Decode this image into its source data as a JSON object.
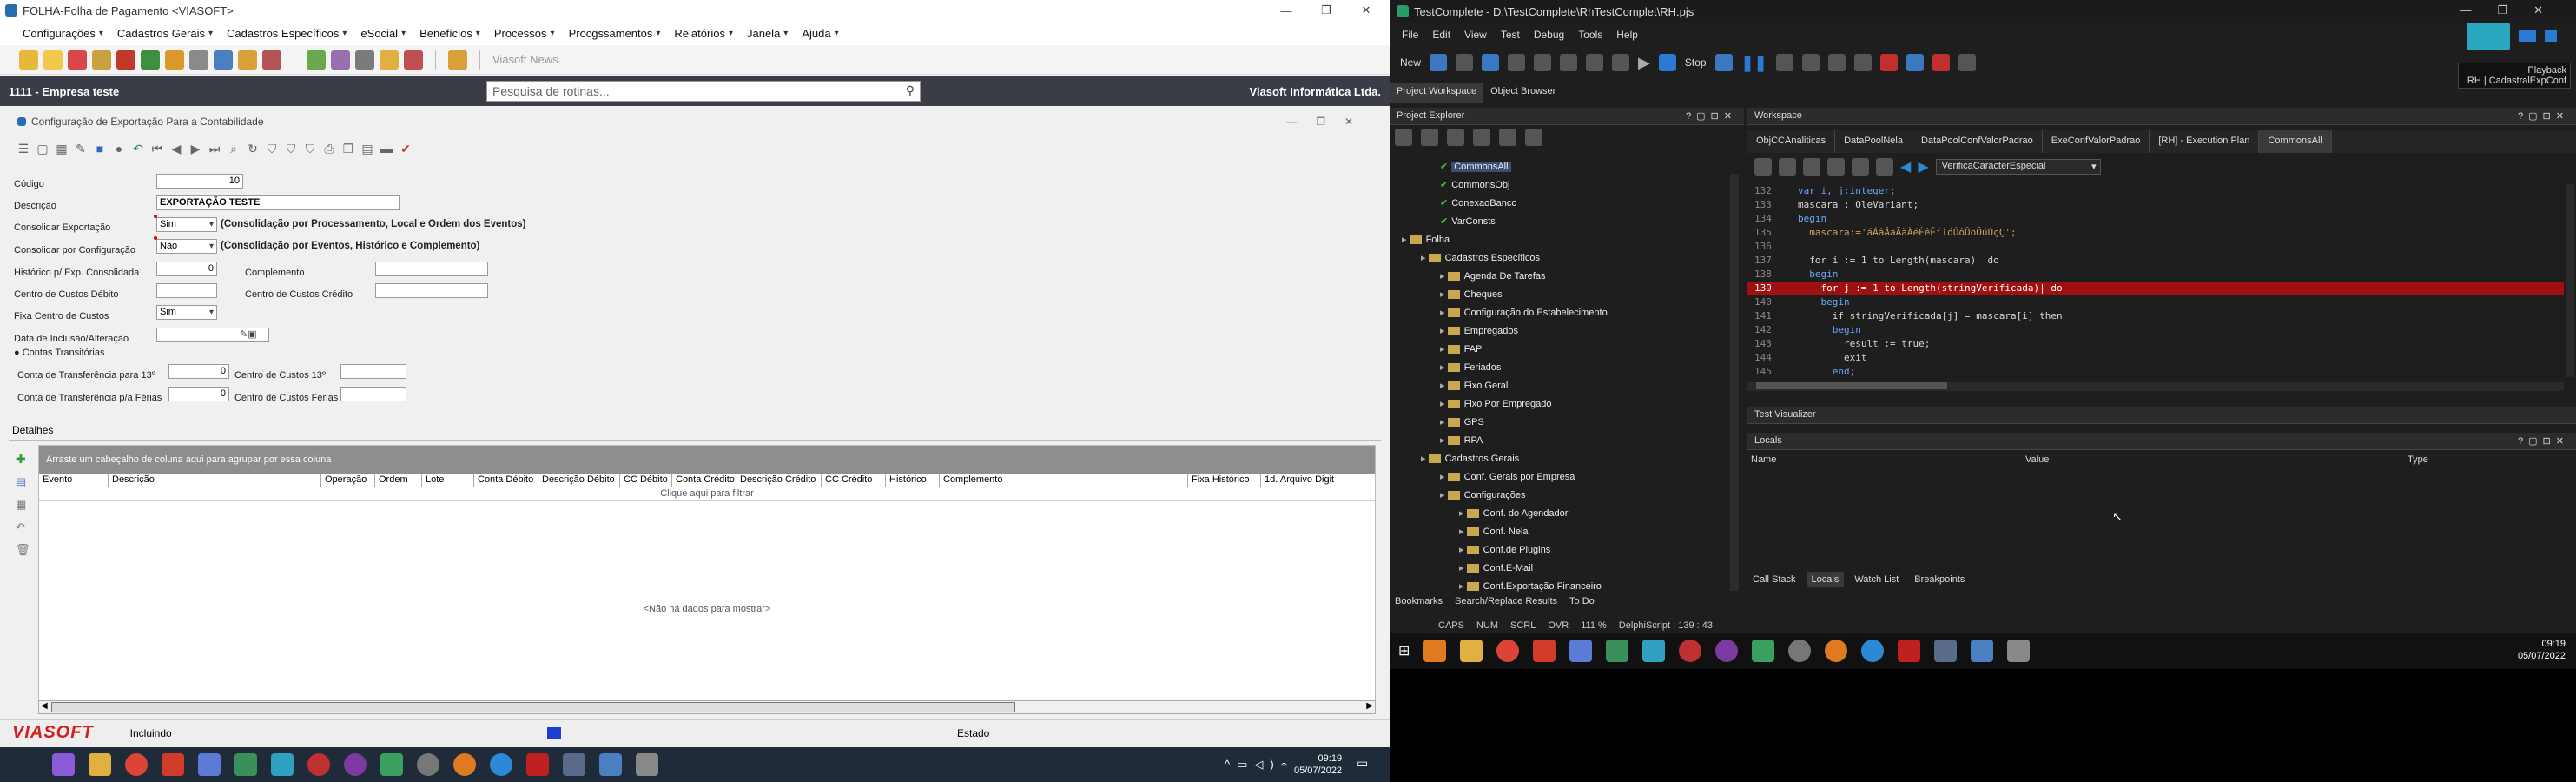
{
  "left_app": {
    "title": "FOLHA-Folha de Pagamento <VIASOFT>",
    "menus": [
      "Configurações",
      "Cadastros Gerais",
      "Cadastros Específicos",
      "eSocial",
      "Benefícios",
      "Processos",
      "Procgssamentos",
      "Relatórios",
      "Janela",
      "Ajuda"
    ],
    "news_label": "Viasoft News",
    "company": "1111 - Empresa teste",
    "search_placeholder": "Pesquisa de rotinas...",
    "brand": "Viasoft Informática Ltda.",
    "form_title": "Configuração de Exportação Para a Contabilidade",
    "fields": {
      "codigo_label": "Código",
      "codigo_value": "10",
      "descricao_label": "Descrição",
      "descricao_value": "EXPORTAÇÃO TESTE",
      "consolidar_exp_label": "Consolidar Exportação",
      "consolidar_exp_value": "Sim",
      "consolidar_exp_hint": "(Consolidação por Processamento, Local e Ordem dos Eventos)",
      "consolidar_cfg_label": "Consolidar por Configuração",
      "consolidar_cfg_value": "Não",
      "consolidar_cfg_hint": "(Consolidação por Eventos, Histórico e Complemento)",
      "historico_label": "Histórico p/ Exp. Consolidada",
      "historico_value": "0",
      "complemento_label": "Complemento",
      "cc_debito_label": "Centro de Custos Débito",
      "cc_credito_label": "Centro de Custos Crédito",
      "fixa_cc_label": "Fixa Centro de Custos",
      "fixa_cc_value": "Sim",
      "data_label": "Data de Inclusão/Alteração",
      "contas_label": "Contas Transitórias",
      "ct13_label": "Conta de Transferência para 13º",
      "ct13_value": "0",
      "cc13_label": "Centro de Custos 13º",
      "ctferias_label": "Conta de Transferência p/a Férias",
      "ctferias_value": "0",
      "ccferias_label": "Centro de Custos Férias"
    },
    "tab_label": "Detalhes",
    "group_hint": "Arraste um cabeçalho de coluna aqui para agrupar por essa coluna",
    "columns": [
      "Evento",
      "Descrição",
      "Operação",
      "Ordem",
      "Lote",
      "Conta Débito",
      "Descrição Débito",
      "CC Débito",
      "Conta Crédito",
      "Descrição Crédito",
      "CC Crédito",
      "Histórico",
      "Complemento",
      "Fixa Histórico",
      "1d. Arquivo Digita"
    ],
    "filter_hint": "Clique aqui para filtrar",
    "empty_text": "<Não há dados para mostrar>",
    "logo": "VIASOFT",
    "status_mode": "Incluindo",
    "status_right": "Estado",
    "clock_time": "09:19",
    "clock_date": "05/07/2022"
  },
  "right_app": {
    "title": "TestComplete - D:\\TestComplete\\RhTestComplet\\RH.pjs",
    "menus": [
      "File",
      "Edit",
      "View",
      "Test",
      "Debug",
      "Tools",
      "Help"
    ],
    "new_label": "New",
    "stop_label": "Stop",
    "playback_label": "Playback",
    "playback_sub": "RH | CadastralExpConf",
    "tabs": [
      "Project Workspace",
      "Object Browser"
    ],
    "explorer_title": "Project Explorer",
    "workspace_title": "Workspace",
    "tree": [
      {
        "label": "CommonsAll",
        "indent": 5,
        "type": "check"
      },
      {
        "label": "CommonsObj",
        "indent": 5,
        "type": "check"
      },
      {
        "label": "ConexaoBanco",
        "indent": 5,
        "type": "check"
      },
      {
        "label": "VarConsts",
        "indent": 5,
        "type": "check"
      },
      {
        "label": "Folha",
        "indent": 3,
        "type": "folder"
      },
      {
        "label": "Cadastros Específicos",
        "indent": 4,
        "type": "folder"
      },
      {
        "label": "Agenda De Tarefas",
        "indent": 5,
        "type": "folder"
      },
      {
        "label": "Cheques",
        "indent": 5,
        "type": "folder"
      },
      {
        "label": "Configuração do Estabelecimento",
        "indent": 5,
        "type": "folder"
      },
      {
        "label": "Empregados",
        "indent": 5,
        "type": "folder"
      },
      {
        "label": "FAP",
        "indent": 5,
        "type": "folder"
      },
      {
        "label": "Feriados",
        "indent": 5,
        "type": "folder"
      },
      {
        "label": "Fixo Geral",
        "indent": 5,
        "type": "folder"
      },
      {
        "label": "Fixo Por Empregado",
        "indent": 5,
        "type": "folder"
      },
      {
        "label": "GPS",
        "indent": 5,
        "type": "folder"
      },
      {
        "label": "RPA",
        "indent": 5,
        "type": "folder"
      },
      {
        "label": "Cadastros Gerais",
        "indent": 4,
        "type": "folder"
      },
      {
        "label": "Conf. Gerais por Empresa",
        "indent": 5,
        "type": "folder"
      },
      {
        "label": "Configurações",
        "indent": 5,
        "type": "folder"
      },
      {
        "label": "Conf. do Agendador",
        "indent": 6,
        "type": "folder"
      },
      {
        "label": "Conf. Nela",
        "indent": 6,
        "type": "folder"
      },
      {
        "label": "Conf.de Plugins",
        "indent": 6,
        "type": "folder"
      },
      {
        "label": "Conf.E-Mail",
        "indent": 6,
        "type": "folder"
      },
      {
        "label": "Conf.Exportação Financeiro",
        "indent": 6,
        "type": "folder"
      }
    ],
    "editor_tabs": [
      "ObjCCAnaliticas",
      "DataPoolNela",
      "DataPoolConfValorPadrao",
      "ExeConfValorPadrao",
      "[RH] - Execution Plan",
      "CommonsAll"
    ],
    "routine_select": "VerificaCaracterEspecial",
    "code": [
      {
        "n": "132",
        "t": "var i, j:integer;"
      },
      {
        "n": "133",
        "t": "mascara : OleVariant;"
      },
      {
        "n": "134",
        "t": "begin"
      },
      {
        "n": "135",
        "t": "  mascara:='áÁâÂãÃàÀéÉêÊíÍóÓôÔõÕúÚçÇ';"
      },
      {
        "n": "136",
        "t": ""
      },
      {
        "n": "137",
        "t": "  for i := 1 to Length(mascara)  do"
      },
      {
        "n": "138",
        "t": "  begin"
      },
      {
        "n": "139",
        "t": "    for j := 1 to Length(stringVerificada)| do",
        "bp": true
      },
      {
        "n": "140",
        "t": "    begin"
      },
      {
        "n": "141",
        "t": "      if stringVerificada[j] = mascara[i] then"
      },
      {
        "n": "142",
        "t": "      begin"
      },
      {
        "n": "143",
        "t": "        result := true;"
      },
      {
        "n": "144",
        "t": "        exit"
      },
      {
        "n": "145",
        "t": "      end;"
      }
    ],
    "test_visualizer": "Test Visualizer",
    "locals_title": "Locals",
    "locals_cols": [
      "Name",
      "Value",
      "Type"
    ],
    "bottom_tabs": [
      "Call Stack",
      "Locals",
      "Watch List",
      "Breakpoints"
    ],
    "bookmark_tabs": [
      "Bookmarks",
      "Search/Replace Results",
      "To Do"
    ],
    "status": [
      "CAPS",
      "NUM",
      "SCRL",
      "OVR",
      "111 %",
      "DelphiScript : 139 : 43"
    ],
    "clock_time": "09:19",
    "clock_date": "05/07/2022"
  }
}
